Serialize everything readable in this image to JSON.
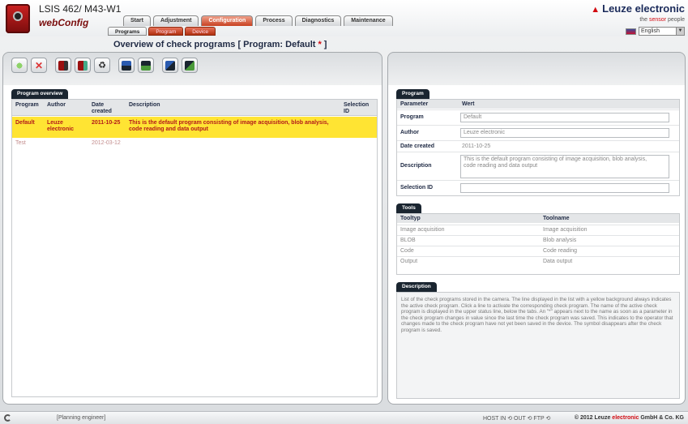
{
  "header": {
    "device_title": "LSIS 462/ M43-W1",
    "logo_text": "webConfig",
    "brand": "Leuze electronic",
    "slogan_prefix": "the ",
    "slogan_red": "sensor",
    "slogan_suffix": " people",
    "language": "English"
  },
  "main_tabs": [
    "Start",
    "Adjustment",
    "Configuration",
    "Process",
    "Diagnostics",
    "Maintenance"
  ],
  "sub_tabs": [
    "Programs",
    "Program",
    "Device"
  ],
  "page_title": {
    "text": "Overview of check programs   [ Program: Default ",
    "asterisk": "*",
    "close": " ]"
  },
  "toolbar": [
    "add-icon",
    "delete-icon",
    "save-to-device-icon",
    "load-from-device-icon",
    "recycle-icon",
    "upload-icon",
    "download-icon",
    "import-icon",
    "export-icon"
  ],
  "overview": {
    "title": "Program overview",
    "columns": {
      "program": "Program",
      "author": "Author",
      "date": "Date created",
      "description": "Description",
      "selection_id": "Selection ID"
    },
    "rows": [
      {
        "program": "Default",
        "author": "Leuze electronic",
        "date": "2011-10-25",
        "description": "This is the default program consisting of image acquisition, blob analysis, code reading and data output",
        "selection_id": ""
      },
      {
        "program": "Test",
        "author": "",
        "date": "2012-03-12",
        "description": "",
        "selection_id": ""
      }
    ]
  },
  "program": {
    "title": "Program",
    "col_param": "Parameter",
    "col_value": "Wert",
    "fields": {
      "program_label": "Program",
      "program_value": "Default",
      "author_label": "Author",
      "author_value": "Leuze electronic",
      "date_label": "Date created",
      "date_value": "2011-10-25",
      "desc_label": "Description",
      "desc_value": "This is the default program consisting of image acquisition, blob analysis, code reading and data output",
      "sel_label": "Selection ID",
      "sel_value": ""
    }
  },
  "tools": {
    "title": "Tools",
    "col_tooltyp": "Tooltyp",
    "col_toolname": "Toolname",
    "rows": [
      {
        "typ": "Image acquisition",
        "name": "Image acquisition"
      },
      {
        "typ": "BLOB",
        "name": "Blob analysis"
      },
      {
        "typ": "Code",
        "name": "Code reading"
      },
      {
        "typ": "Output",
        "name": "Data output"
      }
    ]
  },
  "description": {
    "title": "Description",
    "text": "List of the check programs stored in the camera. The line displayed in the list with a yellow background always indicates the active check program. Click a line to activate the corresponding check program. The name of the active check program is displayed in the upper status line, below the tabs. An \"*\" appears next to the name as soon as a parameter in the check program changes in value since the last time the check program was saved. This indicates to the operator that changes made to the check program have not yet been saved in the device. The symbol disappears after the check program is saved."
  },
  "footer": {
    "user": "[Planning engineer]",
    "status": "HOST IN ⟲ OUT ⟲ FTP ⟲",
    "copy_prefix": "© 2012 Leuze ",
    "copy_red": "electronic",
    "copy_suffix": " GmbH & Co. KG"
  },
  "colors": {
    "accent": "#c74020",
    "active_row": "#ffe433",
    "brand_red": "#d20a11",
    "navy": "#1a2530"
  }
}
